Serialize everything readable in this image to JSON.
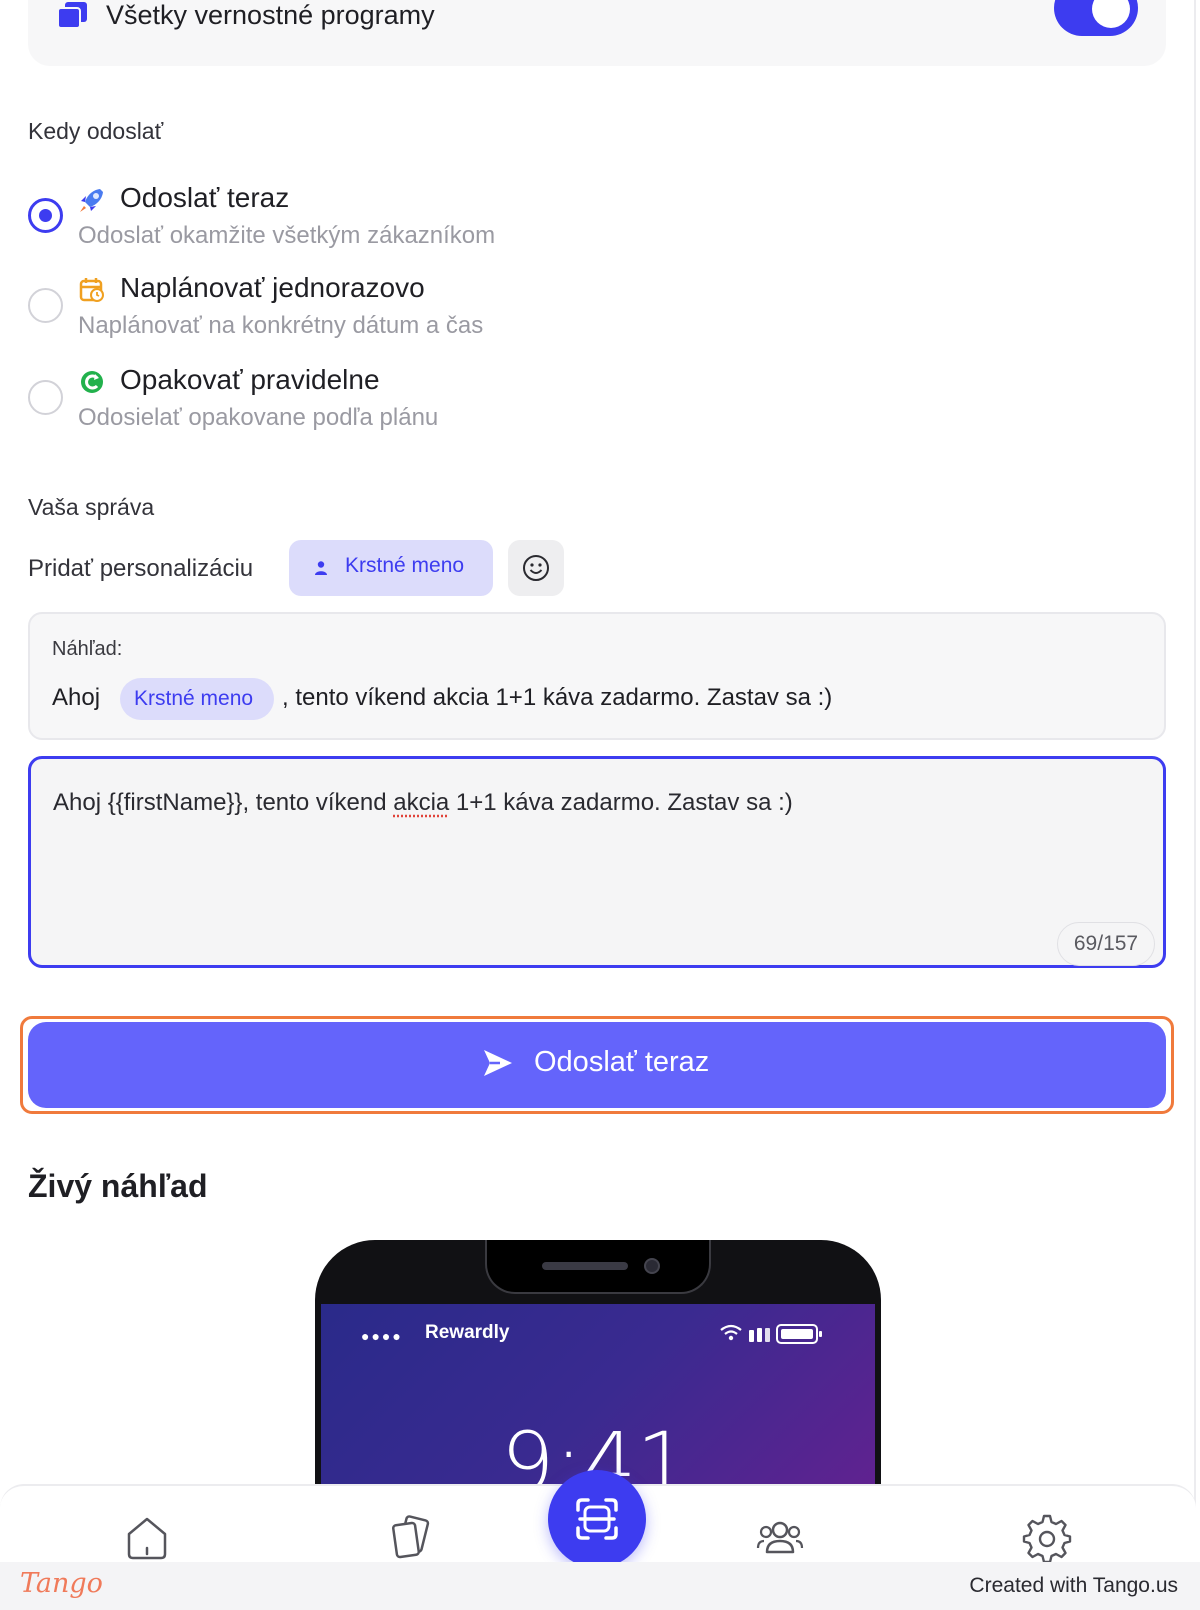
{
  "program": {
    "label": "Všetky vernostné programy",
    "toggle_on": true
  },
  "schedule": {
    "section_label": "Kedy odoslať",
    "options": [
      {
        "title": "Odoslať teraz",
        "description": "Odoslať okamžite všetkým zákazníkom",
        "icon": "rocket-icon",
        "selected": true
      },
      {
        "title": "Naplánovať jednorazovo",
        "description": "Naplánovať na konkrétny dátum a čas",
        "icon": "calendar-icon",
        "selected": false
      },
      {
        "title": "Opakovať pravidelne",
        "description": "Odosielať opakovane podľa plánu",
        "icon": "repeat-icon",
        "selected": false
      }
    ]
  },
  "message": {
    "section_label": "Vaša správa",
    "personalization_label": "Pridať personalizáciu",
    "first_name_chip": "Krstné meno",
    "emoji_button": "smiley-icon",
    "preview_label": "Náhľad:",
    "preview_greeting": "Ahoj",
    "preview_chip": "Krstné meno",
    "preview_rest": ", tento víkend akcia 1+1 káva zadarmo. Zastav sa :)",
    "input_before": "Ahoj {{firstName}}, tento víkend ",
    "input_misspelled": "akcia",
    "input_after": " 1+1 káva zadarmo. Zastav sa :)",
    "char_count": "69/157"
  },
  "send_button": {
    "label": "Odoslať teraz",
    "icon": "send-icon"
  },
  "live_preview": {
    "title": "Živý náhľad",
    "carrier": "Rewardly",
    "signal_dots": "●●●●",
    "clock": "9:41"
  },
  "bottom_nav": {
    "items": [
      "home-icon",
      "cards-icon",
      "scan-icon",
      "customers-icon",
      "settings-icon"
    ]
  },
  "footer": {
    "logo": "Tango",
    "credit": "Created with Tango.us"
  },
  "colors": {
    "accent": "#3d3cf0",
    "button": "#6464fb",
    "highlight": "#f07a3c",
    "chip_bg": "#dcdcfb"
  }
}
